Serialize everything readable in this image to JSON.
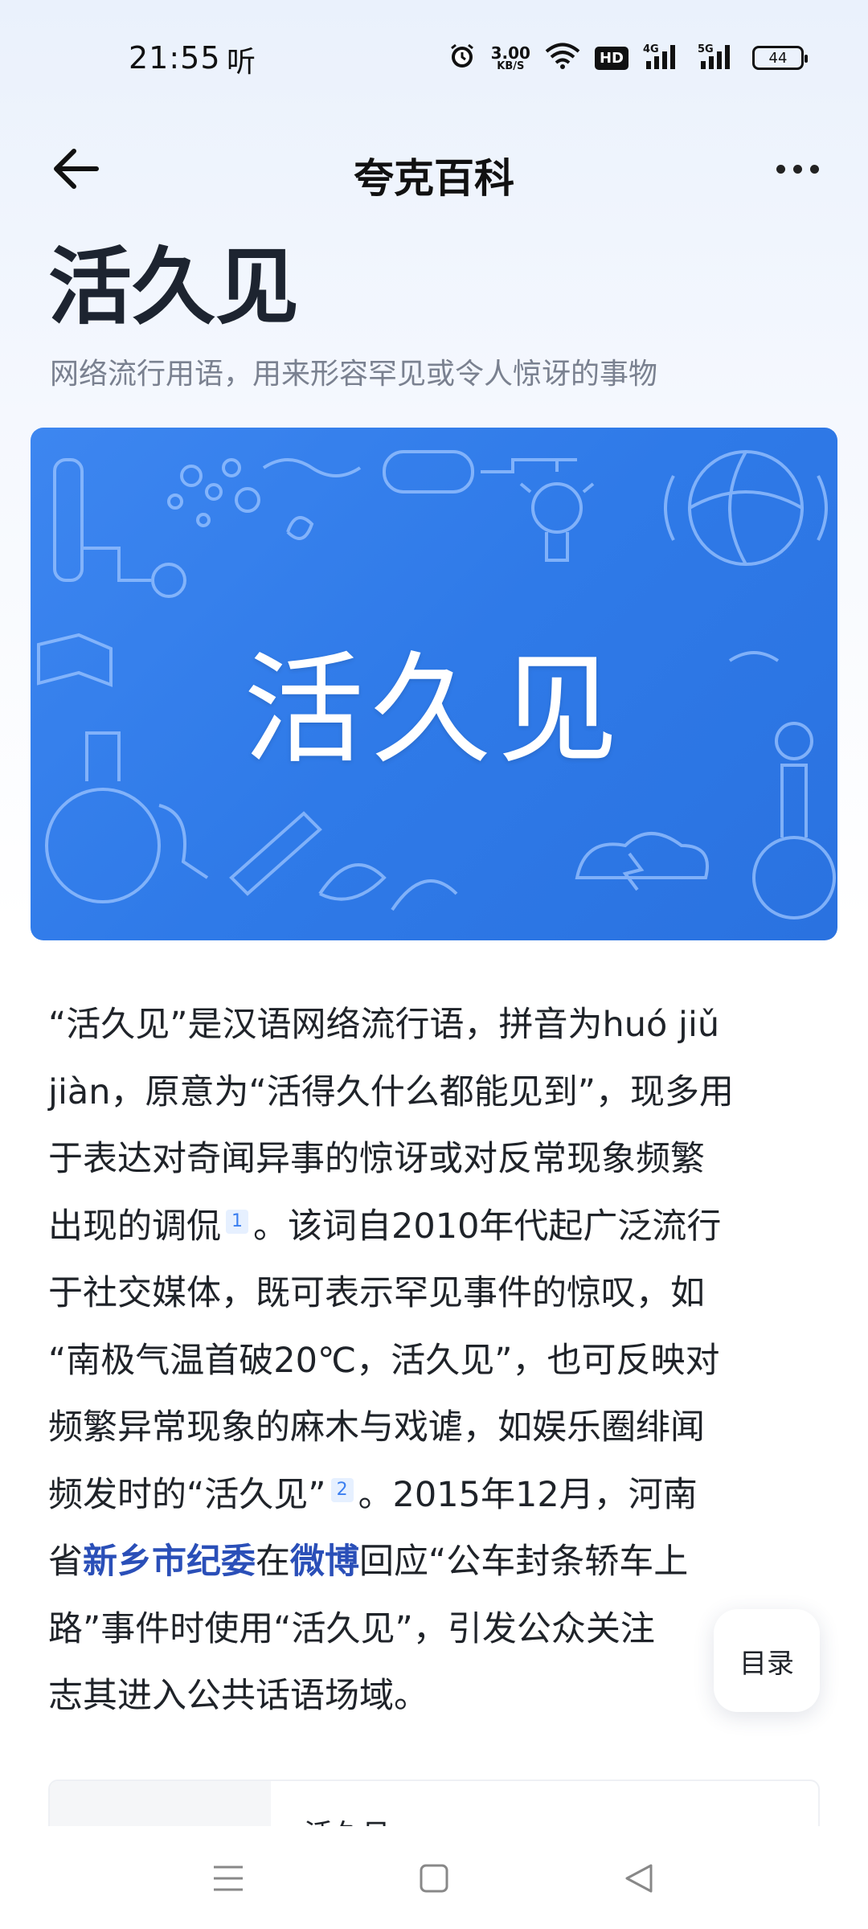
{
  "status_bar": {
    "time": "21:55",
    "listen_label": "听",
    "speed_value": "3.00",
    "speed_unit": "KB/S",
    "hd_label": "HD",
    "network_4g": "4G",
    "network_5g": "5G",
    "battery": "44",
    "icons": [
      "alarm-icon",
      "wifi-icon",
      "signal-icon"
    ]
  },
  "nav": {
    "title": "夸克百科",
    "icons": [
      "back-arrow-icon",
      "more-dots-icon"
    ]
  },
  "entry": {
    "title": "活久见",
    "subtitle": "网络流行用语，用来形容罕见或令人惊讶的事物"
  },
  "banner": {
    "text": "活久见",
    "background_color": "#3583ee"
  },
  "article": {
    "l1": "“活久见”是汉语网络流行语，拼音为huó jiǔ",
    "l2": "jiàn，原意为“活得久什么都能见到”，现多用",
    "l3": "于表达对奇闻异事的惊讶或对反常现象频繁",
    "l4a": "出现的调侃",
    "cite1": "1",
    "l4b": "。该词自2010年代起广泛流行",
    "l5": "于社交媒体，既可表示罕见事件的惊叹，如",
    "l6": "“南极气温首破20℃，活久见”，也可反映对",
    "l7": "频繁异常现象的麻木与戏谑，如娱乐圈绯闻",
    "l8a": "频发时的“活久见”",
    "cite2": "2",
    "l8b": "。2015年12月，河南",
    "l9a": "省",
    "l9_link1": "新乡市纪委",
    "l9b": "在",
    "l9_link2": "微博",
    "l9c": "回应“公车封条轿车上",
    "l10": "路”事件时使用“活久见”，引发公众关注",
    "l11": "志其进入公共话语场域。"
  },
  "toc": {
    "label": "目录"
  },
  "infobox": {
    "partial_value": "活久见"
  },
  "system_nav": {
    "icons": [
      "menu-icon",
      "home-square-icon",
      "back-triangle-icon"
    ]
  },
  "colors": {
    "link": "#2a4fb8",
    "citation": "#3a7ef0",
    "banner": "#3583ee"
  }
}
